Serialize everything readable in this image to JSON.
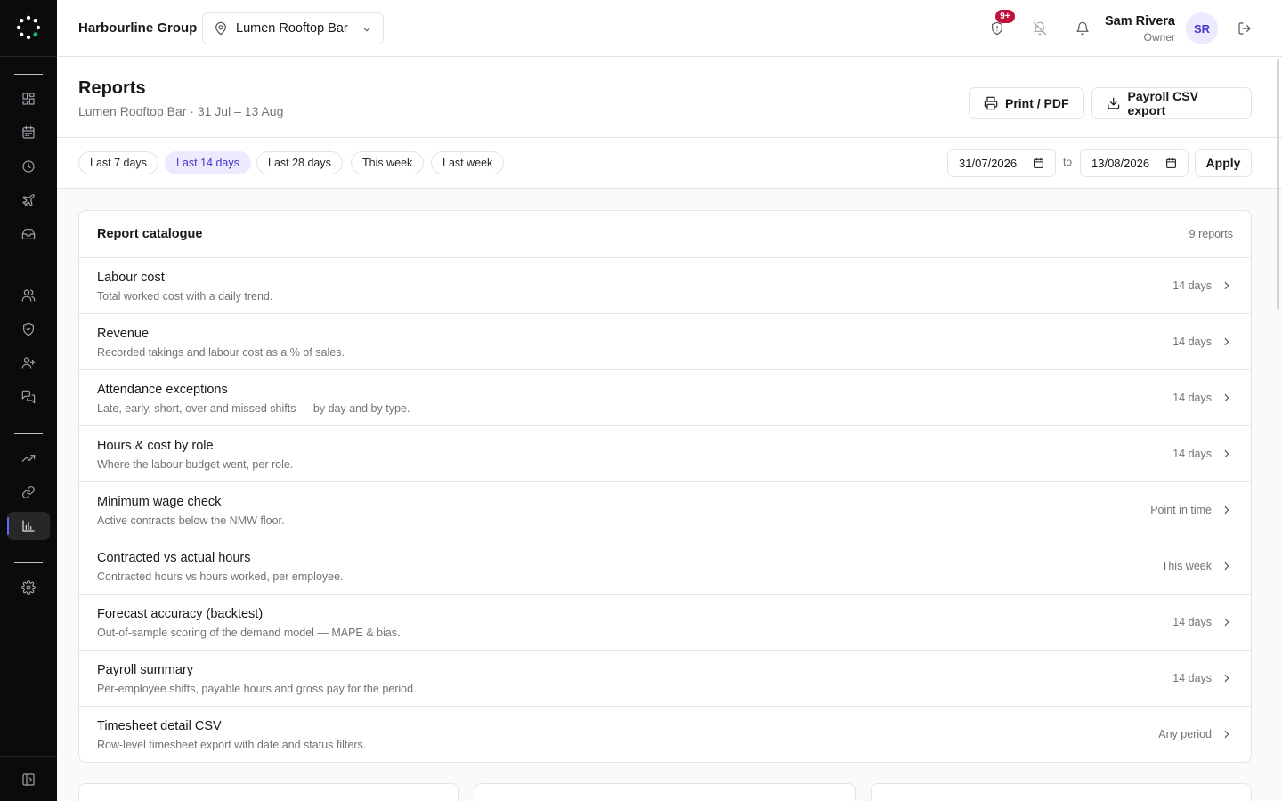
{
  "header": {
    "org_name": "Harbourline Group",
    "location": "Lumen Rooftop Bar",
    "badge_count": "9+",
    "user_name": "Sam Rivera",
    "user_role": "Owner",
    "user_initials": "SR"
  },
  "page": {
    "title": "Reports",
    "subtitle": "Lumen Rooftop Bar · 31 Jul – 13 Aug",
    "print_label": "Print / PDF",
    "payroll_label": "Payroll CSV export"
  },
  "filters": {
    "chips": [
      "Last 7 days",
      "Last 14 days",
      "Last 28 days",
      "This week",
      "Last week"
    ],
    "active_chip": "Last 14 days",
    "date_from": "31/07/2026",
    "to_label": "to",
    "date_to": "13/08/2026",
    "apply_label": "Apply"
  },
  "catalogue": {
    "title": "Report catalogue",
    "count": "9 reports",
    "reports": [
      {
        "name": "Labour cost",
        "desc": "Total worked cost with a daily trend.",
        "period": "14 days"
      },
      {
        "name": "Revenue",
        "desc": "Recorded takings and labour cost as a % of sales.",
        "period": "14 days"
      },
      {
        "name": "Attendance exceptions",
        "desc": "Late, early, short, over and missed shifts — by day and by type.",
        "period": "14 days"
      },
      {
        "name": "Hours & cost by role",
        "desc": "Where the labour budget went, per role.",
        "period": "14 days"
      },
      {
        "name": "Minimum wage check",
        "desc": "Active contracts below the NMW floor.",
        "period": "Point in time"
      },
      {
        "name": "Contracted vs actual hours",
        "desc": "Contracted hours vs hours worked, per employee.",
        "period": "This week"
      },
      {
        "name": "Forecast accuracy (backtest)",
        "desc": "Out-of-sample scoring of the demand model — MAPE & bias.",
        "period": "14 days"
      },
      {
        "name": "Payroll summary",
        "desc": "Per-employee shifts, payable hours and gross pay for the period.",
        "period": "14 days"
      },
      {
        "name": "Timesheet detail CSV",
        "desc": "Row-level timesheet export with date and status filters.",
        "period": "Any period"
      }
    ]
  },
  "sidebar": {
    "icons": [
      "dashboard-icon",
      "calendar-icon",
      "clock-icon",
      "plane-icon",
      "inbox-icon",
      "users-icon",
      "shield-check-icon",
      "user-plus-icon",
      "messages-icon",
      "trending-up-icon",
      "link-icon",
      "bar-chart-icon",
      "settings-icon",
      "collapse-sidebar-icon"
    ],
    "active": "bar-chart-icon"
  },
  "colors": {
    "accent": "#4338ca",
    "accent_bg": "#ede9fe",
    "badge": "#be123c",
    "sidebar_bg": "#0b0b0c"
  }
}
